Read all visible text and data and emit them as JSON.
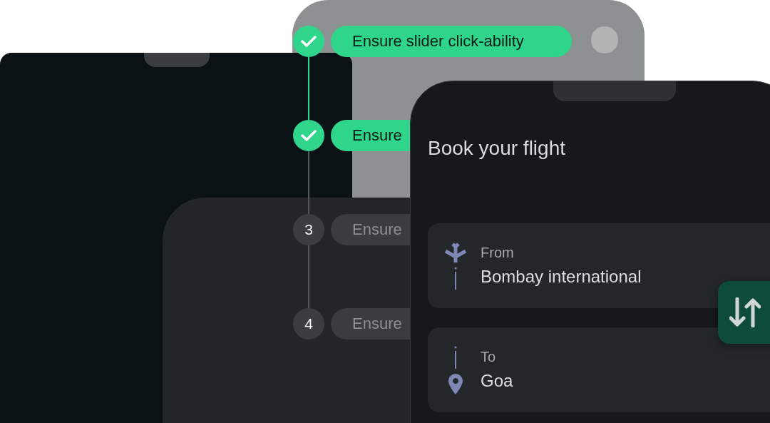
{
  "steps": [
    {
      "done": true,
      "label": "Ensure slider click-ability"
    },
    {
      "done": true,
      "label": "Ensure"
    },
    {
      "done": false,
      "number": "3",
      "label": "Ensure"
    },
    {
      "done": false,
      "number": "4",
      "label": "Ensure"
    }
  ],
  "flight": {
    "title": "Book your flight",
    "from": {
      "label": "From",
      "value": "Bombay international"
    },
    "to": {
      "label": "To",
      "value": "Goa"
    }
  }
}
